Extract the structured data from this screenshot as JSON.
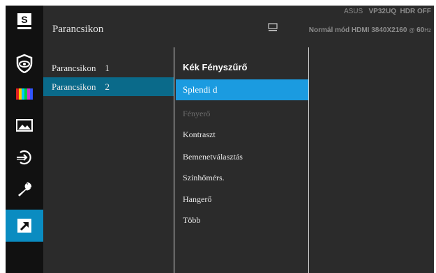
{
  "header": {
    "title": "Parancsikon",
    "model_brand": "ASUS",
    "model_name": "VP32UQ",
    "hdr_status": "HDR OFF",
    "mode": "Normál mód",
    "input": "HDMI",
    "resolution": "3840X2160",
    "at": "@",
    "refresh_value": "60",
    "refresh_unit": "Hz"
  },
  "sidebar": {
    "items": [
      {
        "icon": "splendid-s-icon"
      },
      {
        "icon": "eye-care-icon"
      },
      {
        "icon": "color-bars-icon"
      },
      {
        "icon": "image-landscape-icon"
      },
      {
        "icon": "input-select-icon"
      },
      {
        "icon": "wrench-icon"
      },
      {
        "icon": "shortcut-arrow-icon",
        "active": true
      }
    ]
  },
  "submenu": {
    "items": [
      {
        "label": "Parancsikon",
        "num": "1"
      },
      {
        "label": "Parancsikon",
        "num": "2",
        "selected": true
      }
    ]
  },
  "options": {
    "items": [
      {
        "label": "Kék Fényszűrő"
      },
      {
        "label": "Splendi  d"
      },
      {
        "label": "Fényerő"
      },
      {
        "label": " Kontraszt"
      },
      {
        "label": " Bemenetválasztás"
      },
      {
        "label": "Színhőmérs."
      },
      {
        "label": "Hangerő"
      },
      {
        "label": "Több"
      }
    ]
  },
  "colors": {
    "accent": "#1b9be0",
    "selected_row": "#0a6a8a",
    "panel_bg": "#2b2b2b",
    "rail_bg": "#111111"
  }
}
